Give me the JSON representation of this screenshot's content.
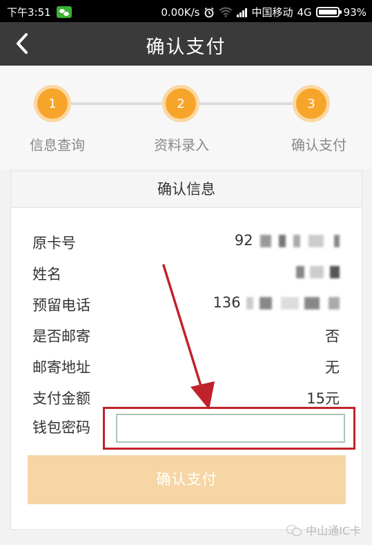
{
  "status_bar": {
    "time": "下午3:51",
    "network_speed": "0.00K/s",
    "carrier": "中国移动",
    "network_type": "4G",
    "battery": "93%"
  },
  "header": {
    "title": "确认支付",
    "back_icon": "chevron-left-icon"
  },
  "stepper": {
    "steps": [
      {
        "number": "1",
        "label": "信息查询"
      },
      {
        "number": "2",
        "label": "资料录入"
      },
      {
        "number": "3",
        "label": "确认支付"
      }
    ],
    "accent_color": "#f7a52a"
  },
  "card": {
    "title": "确认信息",
    "rows": [
      {
        "label": "原卡号",
        "value": "92"
      },
      {
        "label": "姓名",
        "value": ""
      },
      {
        "label": "预留电话",
        "value": "136"
      },
      {
        "label": "是否邮寄",
        "value": "否"
      },
      {
        "label": "邮寄地址",
        "value": "无"
      },
      {
        "label": "支付金额",
        "value": "15元"
      }
    ],
    "password_label": "钱包密码",
    "password_value": "",
    "confirm_button": "确认支付"
  },
  "annotation": {
    "highlight_color": "#c0222a"
  },
  "watermark": {
    "text": "中山通IC卡"
  }
}
